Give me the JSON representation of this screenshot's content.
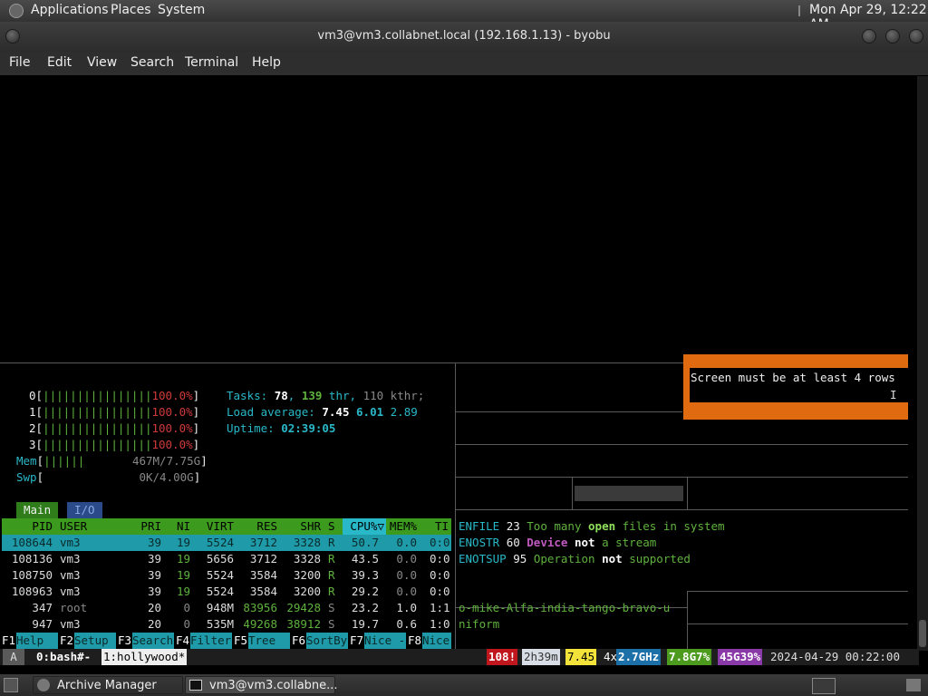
{
  "top_panel": {
    "apps": "Applications",
    "places": "Places",
    "system": "System",
    "clock": "Mon Apr 29, 12:22 AM"
  },
  "window": {
    "title": "vm3@vm3.collabnet.local (192.168.1.13) - byobu"
  },
  "menu": [
    "File",
    "Edit",
    "View",
    "Search",
    "Terminal",
    "Help"
  ],
  "htop": {
    "cpus": [
      {
        "id": "0",
        "bar": "||||||||||||||||",
        "val": "100.0%"
      },
      {
        "id": "1",
        "bar": "||||||||||||||||",
        "val": "100.0%"
      },
      {
        "id": "2",
        "bar": "||||||||||||||||",
        "val": "100.0%"
      },
      {
        "id": "3",
        "bar": "||||||||||||||||",
        "val": "100.0%"
      }
    ],
    "mem": {
      "label": "Mem",
      "bar": "||||||",
      "val": "467M/7.75G"
    },
    "swp": {
      "label": "Swp",
      "val": "0K/4.00G"
    },
    "tasks": {
      "label": "Tasks:",
      "n": "78",
      "thr": "139",
      "thr_l": "thr,",
      "kthr": "110 kthr;"
    },
    "load": {
      "label": "Load average:",
      "a": "7.45",
      "b": "6.01",
      "c": "2.89"
    },
    "uptime": {
      "label": "Uptime:",
      "val": "02:39:05"
    },
    "tabs": [
      "Main",
      "I/O"
    ],
    "headers": [
      "PID",
      "USER",
      "PRI",
      "NI",
      "VIRT",
      "RES",
      "SHR",
      "S",
      "CPU%▽",
      "MEM%",
      "TI"
    ],
    "rows": [
      [
        "108644",
        "vm3",
        "39",
        "19",
        "5524",
        "3712",
        "3328",
        "R",
        "50.7",
        "0.0",
        "0:0"
      ],
      [
        "108136",
        "vm3",
        "39",
        "19",
        "5656",
        "3712",
        "3328",
        "R",
        "43.5",
        "0.0",
        "0:0"
      ],
      [
        "108750",
        "vm3",
        "39",
        "19",
        "5524",
        "3584",
        "3200",
        "R",
        "39.3",
        "0.0",
        "0:0"
      ],
      [
        "108963",
        "vm3",
        "39",
        "19",
        "5524",
        "3584",
        "3200",
        "R",
        "29.2",
        "0.0",
        "0:0"
      ],
      [
        "347",
        "root",
        "20",
        "0",
        "948M",
        "83956",
        "29428",
        "S",
        "23.2",
        "1.0",
        "1:1"
      ],
      [
        "947",
        "vm3",
        "20",
        "0",
        "535M",
        "49268",
        "38912",
        "S",
        "19.7",
        "0.6",
        "1:0"
      ]
    ],
    "fkeys": [
      [
        "F1",
        "Help"
      ],
      [
        "F2",
        "Setup"
      ],
      [
        "F3",
        "Search"
      ],
      [
        "F4",
        "Filter"
      ],
      [
        "F5",
        "Tree"
      ],
      [
        "F6",
        "SortBy"
      ],
      [
        "F7",
        "Nice -"
      ],
      [
        "F8",
        "Nice"
      ]
    ]
  },
  "popup": {
    "text": "Screen must be at least 4 rows"
  },
  "errors": [
    {
      "code": "ENFILE",
      "num": "23",
      "pre": "Too many",
      "em": "open",
      "post": "files in system"
    },
    {
      "code": "ENOSTR",
      "num": "60",
      "pre": "",
      "em": "Device",
      "mid": "not",
      "post": "a stream"
    },
    {
      "code": "ENOTSUP",
      "num": "95",
      "pre": "Operation",
      "em": "not",
      "post": "supported"
    }
  ],
  "phonetic": {
    "l1": "o-mike-Alfa-india-tango-bravo-u",
    "l2": "niform"
  },
  "status": {
    "a": "A",
    "win0": "0:bash#-",
    "win1": "1:hollywood*",
    "alert": "108!",
    "up": "2h39m",
    "load": "7.45",
    "cpu_pre": "4x",
    "cpu": "2.7GHz",
    "mem": "7.8G7%",
    "disk": "45G39%",
    "date": "2024-04-29 00:22:00"
  },
  "taskbar": {
    "item1": "Archive Manager",
    "item2": "vm3@vm3.collabne..."
  }
}
